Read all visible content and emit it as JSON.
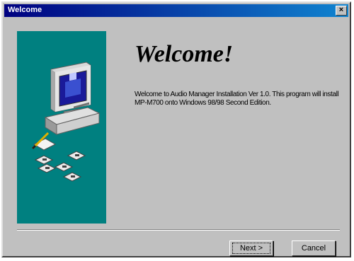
{
  "window": {
    "title": "Welcome",
    "close_label": "×"
  },
  "main": {
    "heading": "Welcome!",
    "body": "Welcome to Audio Manager Installation Ver 1.0. This program will install MP-M700 onto Windows 98/98 Second Edition."
  },
  "buttons": {
    "next_label": "Next >",
    "cancel_label": "Cancel"
  },
  "colors": {
    "titlebar_start": "#000080",
    "titlebar_end": "#1084d0",
    "side_panel": "#008080",
    "face": "#c0c0c0"
  },
  "icons": {
    "illustration": "computer-with-disks-icon"
  }
}
